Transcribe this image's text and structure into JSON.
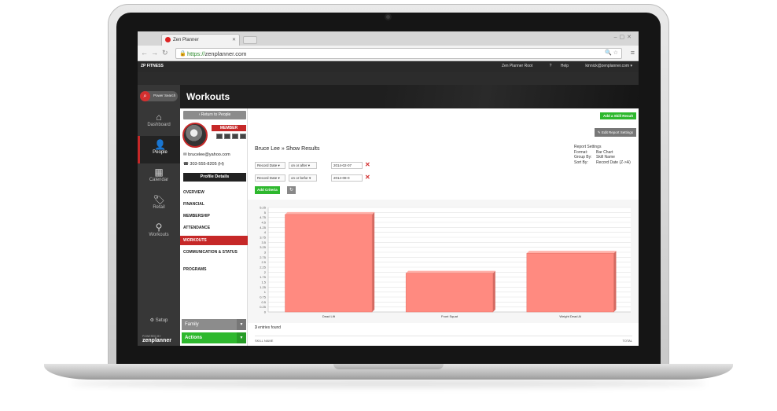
{
  "browser": {
    "tab_title": "Zen Planner",
    "url_scheme": "https://",
    "url_rest": "zenplanner.com"
  },
  "header": {
    "brand": "ZP FITNESS",
    "root_link": "Zen Planner Root",
    "help_link": "Help",
    "user_email": "kinnick@zenplanner.com"
  },
  "sidebar": {
    "search_label": "Power Search",
    "items": [
      {
        "label": "Dashboard",
        "icon": "home-icon"
      },
      {
        "label": "People",
        "icon": "person-icon"
      },
      {
        "label": "Calendar",
        "icon": "calendar-icon"
      },
      {
        "label": "Retail",
        "icon": "tag-icon"
      },
      {
        "label": "Workouts",
        "icon": "kettlebell-icon"
      }
    ],
    "active": "People",
    "setup_label": "Setup",
    "powered_by": "POWERED BY",
    "logo_text": "zenplanner"
  },
  "page": {
    "title": "Workouts"
  },
  "person": {
    "return_label": "Return to People",
    "badge": "MEMBER",
    "email": "brucelee@yahoo.com",
    "phone": "303-555-8205 (H)",
    "profile_button": "Profile Details",
    "nav": [
      "OVERVIEW",
      "FINANCIAL",
      "MEMBERSHIP",
      "ATTENDANCE",
      "WORKOUTS",
      "COMMUNICATION & STATUS",
      "PROGRAMS"
    ],
    "active_nav": "WORKOUTS",
    "family_label": "Family",
    "actions_label": "Actions"
  },
  "report": {
    "add_skill_button": "Add a Skill Result",
    "edit_settings_button": "Edit Report Settings",
    "heading": "Bruce Lee » Show Results",
    "settings_title": "Report Settings",
    "settings": [
      {
        "label": "Format:",
        "value": "Bar Chart"
      },
      {
        "label": "Group By:",
        "value": "Skill Name"
      },
      {
        "label": "Sort By:",
        "value": "Record Date (Z->A)"
      }
    ],
    "criteria": [
      {
        "field": "Record Date",
        "operator": "on or after",
        "value": "2014-02-07"
      },
      {
        "field": "Record Date",
        "operator": "on or befor",
        "value": "2014-08-0"
      }
    ],
    "add_criteria_button": "Add Criteria",
    "entries_count": "3",
    "entries_text": "entries found",
    "col_skill": "SKILL NAME",
    "col_total": "TOTAL"
  },
  "chart_data": {
    "type": "bar",
    "categories": [
      "Dead Lift",
      "Front Squat",
      "Weight Dead Al"
    ],
    "values": [
      4.9,
      1.95,
      2.95
    ],
    "ylim": [
      0,
      5.25
    ],
    "yticks": [
      "0",
      "0.25",
      "0.5",
      "0.75",
      "1",
      "1.25",
      "1.5",
      "1.75",
      "2",
      "2.25",
      "2.5",
      "2.75",
      "3",
      "3.25",
      "3.5",
      "3.75",
      "4",
      "4.25",
      "4.5",
      "4.75",
      "5",
      "5.25"
    ],
    "color": "#ff8a80",
    "grid": true,
    "legend": "none"
  }
}
